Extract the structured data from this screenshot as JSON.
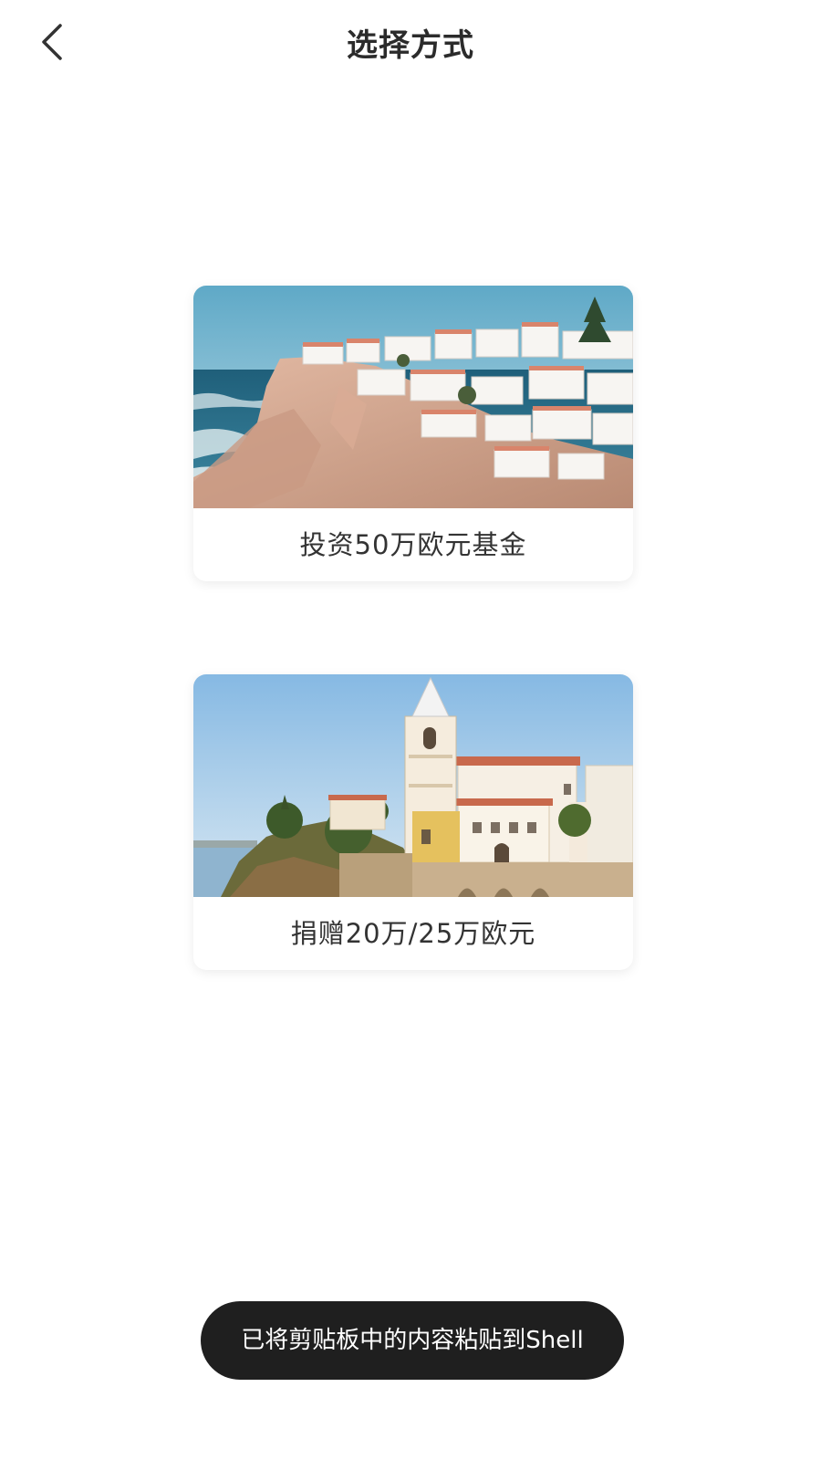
{
  "header": {
    "title": "选择方式",
    "back_icon": "chevron-left-icon"
  },
  "options": [
    {
      "label": "投资50万欧元基金",
      "image": "coastal-town-cliff-photo"
    },
    {
      "label": "捐赠20万/25万欧元",
      "image": "church-bell-tower-photo"
    }
  ],
  "toast": {
    "message": "已将剪贴板中的内容粘贴到Shell"
  },
  "colors": {
    "title": "#2b2b2b",
    "toast_bg": "#1f1f1f",
    "toast_text": "#ffffff"
  }
}
